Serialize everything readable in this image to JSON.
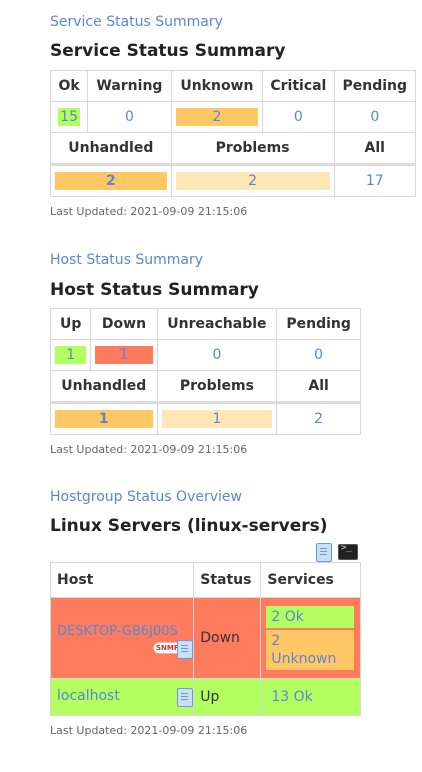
{
  "service_summary": {
    "link": "Service Status Summary",
    "title": "Service Status Summary",
    "headers": [
      "Ok",
      "Warning",
      "Unknown",
      "Critical",
      "Pending"
    ],
    "values": [
      "15",
      "0",
      "2",
      "0",
      "0"
    ],
    "sub_headers": [
      "Unhandled",
      "Problems",
      "All"
    ],
    "sub_values": [
      "2",
      "2",
      "17"
    ],
    "updated": "Last Updated: 2021-09-09 21:15:06"
  },
  "host_summary": {
    "link": "Host Status Summary",
    "title": "Host Status Summary",
    "headers": [
      "Up",
      "Down",
      "Unreachable",
      "Pending"
    ],
    "values": [
      "1",
      "1",
      "0",
      "0"
    ],
    "sub_headers": [
      "Unhandled",
      "Problems",
      "All"
    ],
    "sub_values": [
      "1",
      "1",
      "2"
    ],
    "updated": "Last Updated: 2021-09-09 21:15:06"
  },
  "hostgroup": {
    "link": "Hostgroup Status Overview",
    "title": "Linux Servers (linux-servers)",
    "columns": [
      "Host",
      "Status",
      "Services"
    ],
    "rows": [
      {
        "host": "DESKTOP-GB6J00S",
        "status": "Down",
        "services": [
          "2 Ok",
          "2 Unknown"
        ]
      },
      {
        "host": "localhost",
        "status": "Up",
        "services": [
          "13 Ok"
        ]
      }
    ],
    "snmp_label": "SNMP",
    "updated": "Last Updated: 2021-09-09 21:15:06"
  },
  "colors": {
    "ok": "#b2ff5f",
    "down": "#ff7b5e",
    "unknown": "#ffc864",
    "problem_light": "#ffe6b6",
    "link": "#5a86d6"
  },
  "icons": [
    "service-detail-icon",
    "command-icon",
    "snmp-icon"
  ]
}
